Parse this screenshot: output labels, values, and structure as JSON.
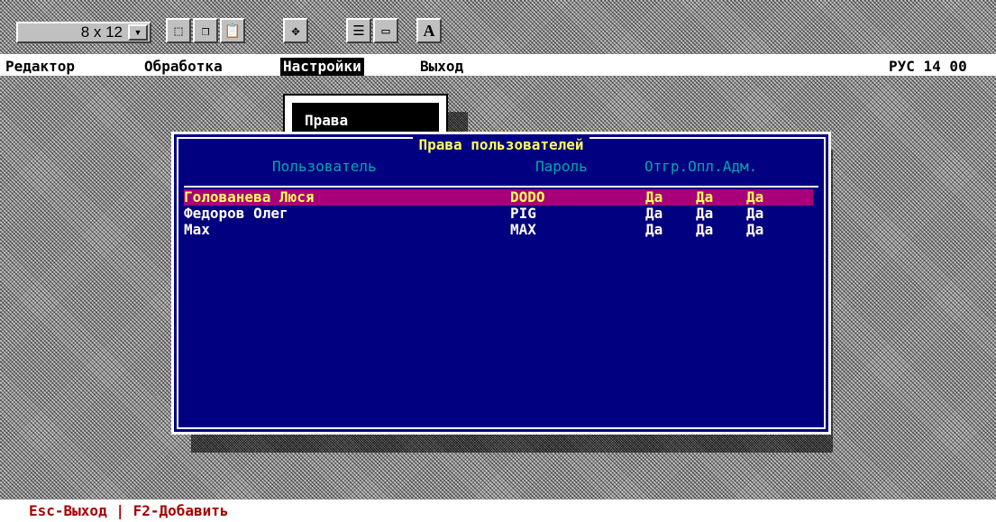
{
  "toolbar": {
    "font_size_value": "8 x 12",
    "buttons": [
      {
        "name": "select-icon",
        "glyph": "⬚"
      },
      {
        "name": "copy-icon",
        "glyph": "❐"
      },
      {
        "name": "paste-icon",
        "glyph": "📋"
      },
      {
        "name": "fullscreen-icon",
        "glyph": "✥"
      },
      {
        "name": "properties-icon",
        "glyph": "☰"
      },
      {
        "name": "background-icon",
        "glyph": "▭"
      },
      {
        "name": "font-icon",
        "glyph": "A"
      }
    ]
  },
  "menubar": {
    "items": [
      "Редактор",
      "Обработка",
      "Настройки",
      "Выход"
    ],
    "active_index": 2,
    "indicator": "РУС 14 00"
  },
  "submenu": {
    "label": "Права"
  },
  "dialog": {
    "title": "Права пользователей",
    "columns": {
      "user": "Пользователь",
      "password": "Пароль",
      "flags": "Отгр.Опл.Адм."
    },
    "rows": [
      {
        "user": "Голованева Люся",
        "password": "DODO",
        "otgr": "Да",
        "opl": "Да",
        "adm": "Да",
        "selected": true
      },
      {
        "user": "Федоров Олег",
        "password": "PIG",
        "otgr": "Да",
        "opl": "Да",
        "adm": "Да",
        "selected": false
      },
      {
        "user": "Max",
        "password": "MAX",
        "otgr": "Да",
        "opl": "Да",
        "adm": "Да",
        "selected": false
      }
    ]
  },
  "statusbar": {
    "text": "Esc-Выход | F2-Добавить"
  },
  "colors": {
    "dialog_bg": "#000080",
    "selected_row": "#a8007a",
    "title": "#ffff55",
    "header": "#00a8a8",
    "status": "#a80000"
  }
}
